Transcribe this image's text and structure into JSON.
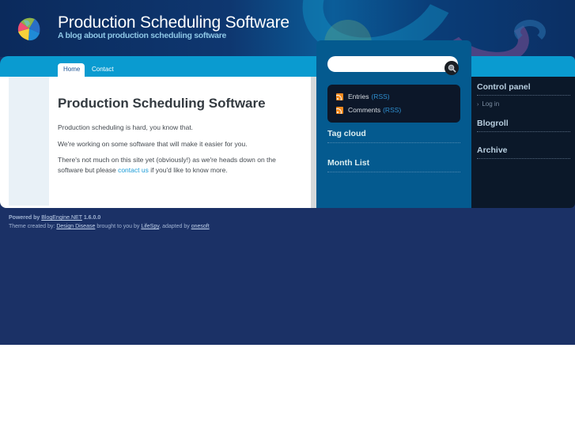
{
  "header": {
    "title": "Production Scheduling Software",
    "tagline": "A blog about production scheduling software",
    "logo_icon": "colorful-orb-logo"
  },
  "nav": {
    "tabs": [
      {
        "label": "Home",
        "active": true
      },
      {
        "label": "Contact",
        "active": false
      }
    ]
  },
  "post": {
    "title": "Production Scheduling Software",
    "paragraphs": [
      "Production scheduling is hard, you know that.",
      "We're working on some software that will make it easier for you."
    ],
    "p3_before": "There's not much on this site yet (obviously!) as we're heads down on the software but please ",
    "p3_link": "contact us",
    "p3_after": " if you'd like to know more."
  },
  "sidebar_mid": {
    "search": {
      "value": "",
      "placeholder": "",
      "button_icon": "search-icon"
    },
    "feeds": [
      {
        "label": "Entries",
        "link": "(RSS)"
      },
      {
        "label": "Comments",
        "link": "(RSS)"
      }
    ],
    "headings": {
      "tag_cloud": "Tag cloud",
      "month_list": "Month List"
    }
  },
  "sidebar_right": {
    "control_panel": "Control panel",
    "login": "Log in",
    "login_bullet": "›",
    "blogroll": "Blogroll",
    "archive": "Archive"
  },
  "footer": {
    "powered_by": "Powered by",
    "engine_link": "BlogEngine.NET",
    "version": "1.6.0.0",
    "theme_by": "Theme created by:",
    "designer_link": "Design Disease",
    "brought": "brought to you by",
    "lifespy_link": "LifeSpy",
    "adapted": ", adapted by",
    "onesoft_link": "onesoft"
  },
  "colors": {
    "page_bg": "#1b3166",
    "nav_bar": "#0a9bd0",
    "sidebar_mid": "#045a8f",
    "sidebar_right": "#0b1829",
    "link": "#1a9bd7",
    "rss": "#f28a1f"
  }
}
